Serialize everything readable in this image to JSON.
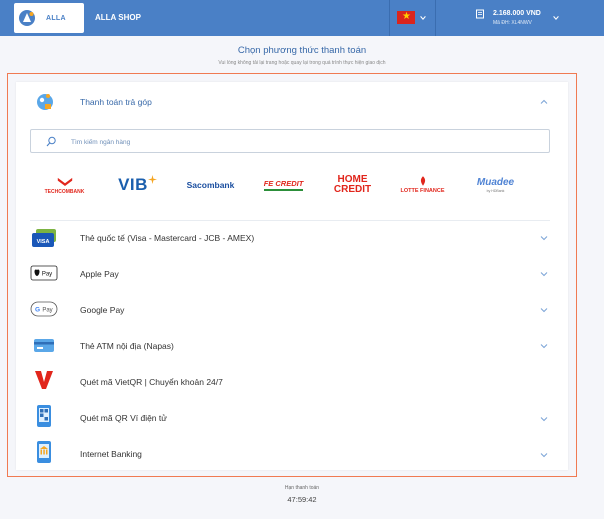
{
  "header": {
    "logo_text": "ALLA",
    "shop_name": "ALLA SHOP",
    "balance": "2.168.000 VND",
    "order_id": "Mã ĐH: XL4NWV",
    "colors": {
      "bar": "#4a80c6",
      "flag": "#da251d"
    }
  },
  "page": {
    "title": "Chọn phương thức thanh toán",
    "subtitle": "Vui lòng không tải lại trang hoặc quay lại trong quá trình thực hiện giao dịch"
  },
  "installment": {
    "label": "Thanh toán trả góp",
    "search_placeholder": "Tìm kiếm ngân hàng",
    "banks": [
      {
        "name": "TECHCOMBANK",
        "color": "#e1261c"
      },
      {
        "name": "VIB",
        "color": "#1b5fae"
      },
      {
        "name": "Sacombank",
        "color": "#1b4fa0"
      },
      {
        "name": "FE CREDIT",
        "color": "#2c8f3a"
      },
      {
        "name": "HOME",
        "name2": "CREDIT",
        "color": "#e1261c"
      },
      {
        "name": "LOTTE FINANCE",
        "color": "#e1261c"
      },
      {
        "name": "Muadee",
        "sub": "by HDBank",
        "color": "#4f83d4"
      }
    ]
  },
  "methods": [
    {
      "label": "Thẻ quốc tế (Visa - Mastercard - JCB - AMEX)",
      "icon": "visa-card-icon",
      "badge": "VISA"
    },
    {
      "label": "Apple Pay",
      "icon": "apple-pay-icon",
      "badge": "Pay"
    },
    {
      "label": "Google Pay",
      "icon": "google-pay-icon",
      "badge": "Pay"
    },
    {
      "label": "Thẻ ATM nội địa (Napas)",
      "icon": "atm-card-icon"
    },
    {
      "label": "Quét mã VietQR | Chuyển khoản 24/7",
      "icon": "vietqr-icon"
    },
    {
      "label": "Quét mã QR Ví điện tử",
      "icon": "qr-wallet-icon"
    },
    {
      "label": "Internet Banking",
      "icon": "internet-banking-icon"
    }
  ],
  "footer": {
    "timer_label": "Hạn thanh toán",
    "timer": "47:59:42"
  }
}
